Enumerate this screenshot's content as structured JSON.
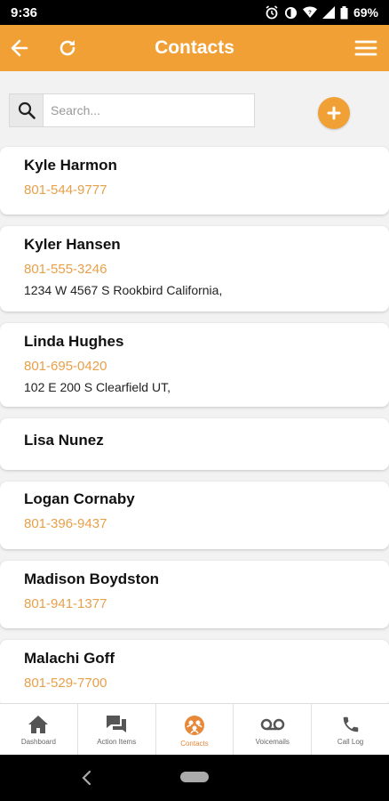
{
  "status_bar": {
    "time": "9:36",
    "battery": "69%"
  },
  "app_bar": {
    "title": "Contacts"
  },
  "search": {
    "placeholder": "Search..."
  },
  "contacts": [
    {
      "name": "Kyle Harmon",
      "phone": "801-544-9777",
      "address": ""
    },
    {
      "name": "Kyler Hansen",
      "phone": "801-555-3246",
      "address": "1234 W 4567 S Rookbird California,"
    },
    {
      "name": "Linda Hughes",
      "phone": "801-695-0420",
      "address": "102 E 200 S Clearfield UT,"
    },
    {
      "name": "Lisa Nunez",
      "phone": "",
      "address": ""
    },
    {
      "name": "Logan Cornaby",
      "phone": "801-396-9437",
      "address": ""
    },
    {
      "name": "Madison Boydston",
      "phone": "801-941-1377",
      "address": ""
    },
    {
      "name": "Malachi Goff",
      "phone": "801-529-7700",
      "address": ""
    }
  ],
  "bottom_nav": {
    "items": [
      {
        "label": "Dashboard",
        "icon": "home-icon",
        "active": false
      },
      {
        "label": "Action Items",
        "icon": "chat-icon",
        "active": false
      },
      {
        "label": "Contacts",
        "icon": "contacts-icon",
        "active": true
      },
      {
        "label": "Voicemails",
        "icon": "voicemail-icon",
        "active": false
      },
      {
        "label": "Call Log",
        "icon": "phone-icon",
        "active": false
      }
    ]
  },
  "colors": {
    "accent": "#f0a035",
    "phone": "#e8a04a",
    "active_nav": "#e8893a"
  }
}
